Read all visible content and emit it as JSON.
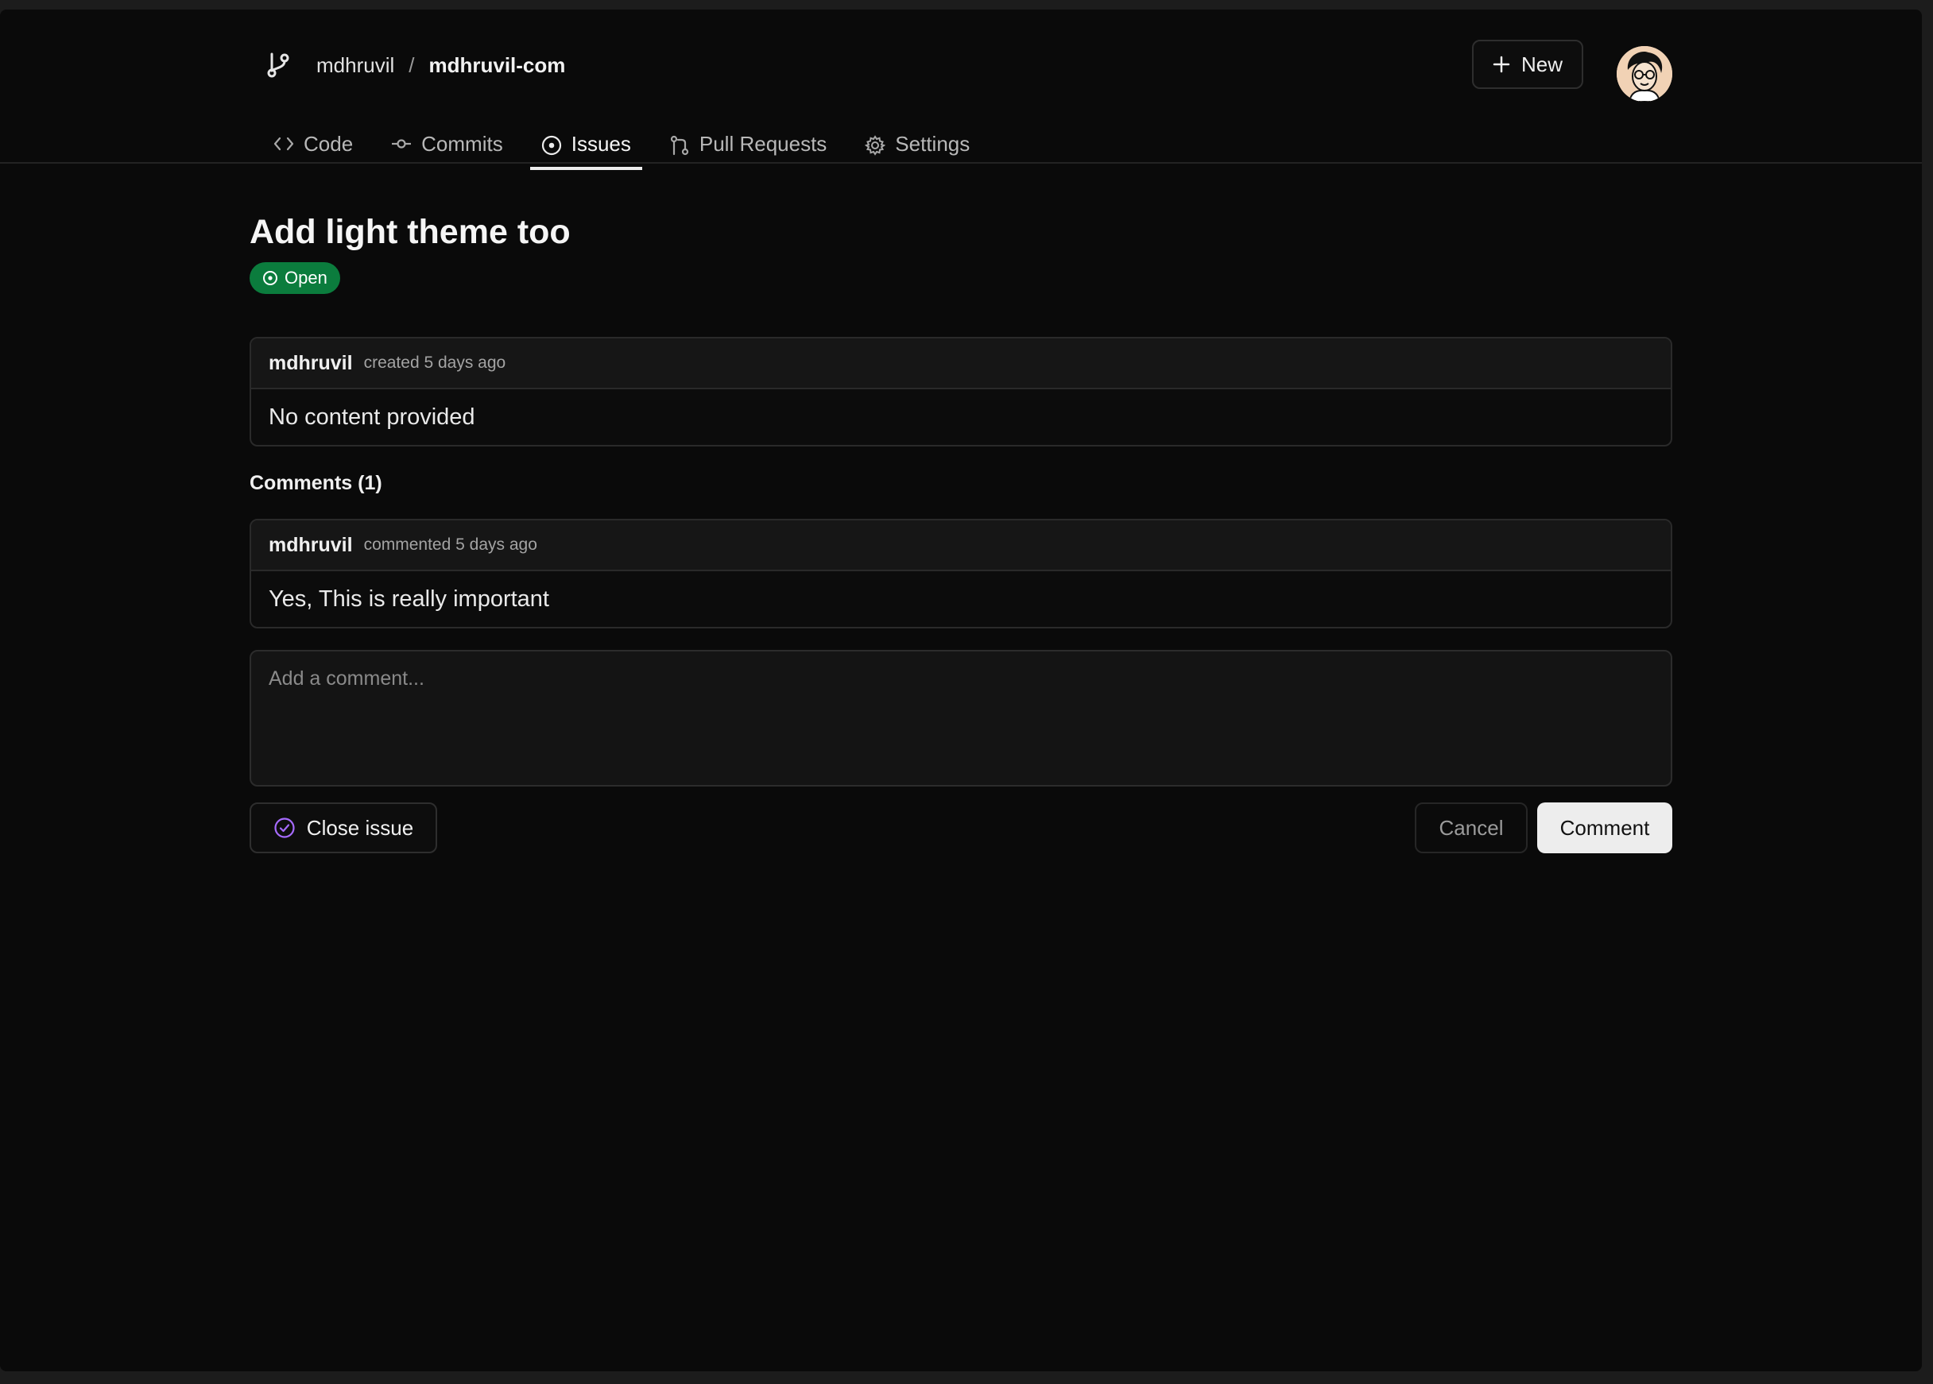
{
  "header": {
    "owner": "mdhruvil",
    "separator": "/",
    "repo": "mdhruvil-com",
    "new_button_label": "New"
  },
  "tabs": [
    {
      "label": "Code",
      "icon": "code-icon"
    },
    {
      "label": "Commits",
      "icon": "commit-icon"
    },
    {
      "label": "Issues",
      "icon": "issue-icon",
      "active": true
    },
    {
      "label": "Pull Requests",
      "icon": "pull-request-icon"
    },
    {
      "label": "Settings",
      "icon": "gear-icon"
    }
  ],
  "issue": {
    "title": "Add light theme too",
    "status": "Open",
    "status_color": "#0b7c3d",
    "author": "mdhruvil",
    "meta": "created 5 days ago",
    "body": "No content provided"
  },
  "comments": {
    "title": "Comments (1)",
    "items": [
      {
        "author": "mdhruvil",
        "meta": "commented 5 days ago",
        "body": "Yes, This is really important"
      }
    ]
  },
  "composer": {
    "placeholder": "Add a comment...",
    "close_label": "Close issue",
    "cancel_label": "Cancel",
    "comment_label": "Comment"
  }
}
